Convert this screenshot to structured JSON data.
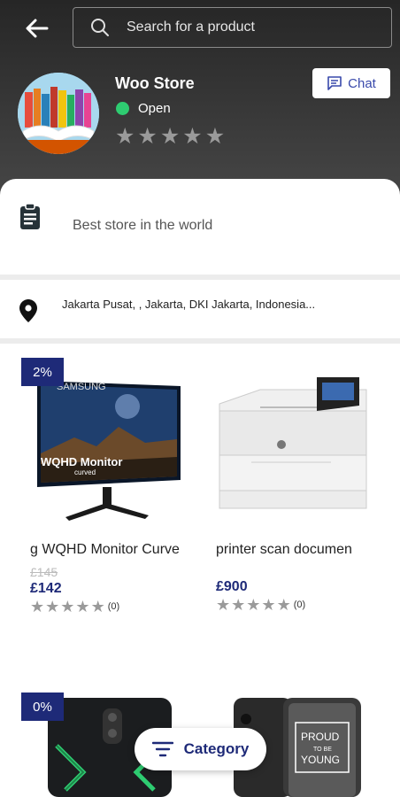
{
  "header": {
    "search_placeholder": "Search for a product",
    "store_name": "Woo Store",
    "status": "Open",
    "chat_label": "Chat",
    "rating": "0 of 5 stars"
  },
  "store": {
    "description": "Best store in the world",
    "address": "Jakarta Pusat, , Jakarta, DKI Jakarta, Indonesia..."
  },
  "products": [
    {
      "title": "g WQHD Monitor Curve",
      "old_price": "£145",
      "price": "£142",
      "discount": "2%",
      "rating_count": "(0)",
      "monitor_brand": "SAMSUNG",
      "monitor_text": "WQHD Monitor",
      "monitor_sub": "curved"
    },
    {
      "title": "printer scan documen",
      "price": "£900",
      "rating_count": "(0)"
    },
    {
      "discount": "0%",
      "phone_text": "PROUD TO BE YOUNG"
    }
  ],
  "category_label": "Category",
  "colors": {
    "accent": "#1e2a78",
    "header_bg": "#333333",
    "online": "#2ecc71",
    "chat": "#3949ab"
  }
}
